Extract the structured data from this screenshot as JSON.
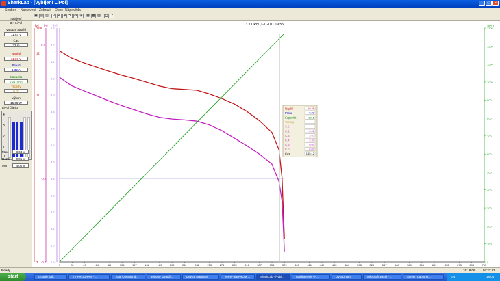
{
  "window": {
    "title": "SharkLab - [vybíjení LiPol]"
  },
  "menu": [
    "Soubor",
    "Nastavení",
    "Zobrazit",
    "Okno",
    "Nápověda"
  ],
  "toolbar": [
    "▣",
    "▤",
    "▥",
    "V",
    "A",
    "⊕",
    "℃",
    "⟳",
    "⊞",
    "▦",
    "▩",
    "▧",
    "⎙",
    "?"
  ],
  "left_panel": {
    "mode": "nabíjení",
    "battery": "3 × LiPol",
    "fields": [
      {
        "label": "Vstupní napětí",
        "value": "11.93 V",
        "color": "#000000"
      },
      {
        "label": "Čas",
        "value": "32 m",
        "color": "#000000"
      },
      {
        "label": "Napětí",
        "value": "11.00 V",
        "color": "#d00000"
      },
      {
        "label": "Proud",
        "value": "1.32 A",
        "color": "#0000c8"
      },
      {
        "label": "Kapacita",
        "value": "704 mAh",
        "color": "#008000"
      },
      {
        "label": "Teploty",
        "value": "0 °C",
        "color": "#c87800"
      },
      {
        "label": "Výkon",
        "value": "15.65 W",
        "color": "#000000"
      }
    ],
    "cells_title": "LiPol články",
    "cells_scale": [
      "4",
      "3",
      "2",
      "1",
      "0"
    ],
    "cell_levels": [
      0,
      0.88,
      0.88,
      0.88,
      0,
      0
    ],
    "max_label": "Max",
    "max_value": "3.63 V",
    "rozdil_label": "Rozd.",
    "rozdil_value": "0.01 V",
    "min_label": "Min",
    "min_value": "4.00 V"
  },
  "chart_data": {
    "type": "line",
    "title": "3 x LiPol [1-1-2011 19:55]",
    "axis_units": {
      "voltage": "[V]",
      "current": "[A]",
      "cells": "[V]",
      "capacity": "[ mAh ]"
    },
    "x_ticks": [
      1,
      22,
      43,
      64,
      85,
      106,
      127,
      148,
      169,
      190,
      211,
      232,
      253,
      274,
      295,
      316,
      337,
      358,
      379,
      400,
      421,
      442,
      463,
      484,
      505,
      526,
      547,
      568,
      589,
      610,
      631,
      652,
      673,
      694,
      715
    ],
    "x_range": [
      1,
      715
    ],
    "voltage_axis": {
      "range": [
        7,
        12.6
      ],
      "ticks": [
        {
          "value": 12.6,
          "label": "12.6"
        },
        {
          "value": 12,
          "label": "12"
        },
        {
          "value": 11,
          "label": "11"
        },
        {
          "value": 7,
          "label": "7"
        }
      ]
    },
    "current_axis": {
      "range": [
        -0.7,
        0.7
      ],
      "ticks": [
        {
          "value": 0.6,
          "label": "0.6"
        },
        {
          "value": -0.2,
          "label": "-0.2"
        },
        {
          "value": -0.7,
          "label": "-0.7"
        }
      ]
    },
    "cell_axis": {
      "range": [
        2.9,
        4.3
      ],
      "ticks": [
        "4.3",
        "4.2",
        "4.1",
        "4.0",
        "3.9",
        "3.8",
        "3.7",
        "3.6",
        "3.5",
        "3.4",
        "3.3",
        "3.2",
        "3.1",
        "3.0",
        "2.9"
      ]
    },
    "capacity_axis": {
      "range": [
        0,
        1300
      ],
      "ticks": [
        "1300",
        "1200",
        "1100",
        "1000",
        "900",
        "800",
        "700",
        "600",
        "500",
        "400",
        "300",
        "200",
        "100",
        "0"
      ]
    },
    "series": [
      {
        "name": "Napětí",
        "color": "#c01818",
        "axis": "voltage",
        "x": [
          1,
          21,
          43,
          64,
          85,
          106,
          127,
          148,
          169,
          190,
          211,
          232,
          253,
          274,
          295,
          316,
          337,
          358,
          370,
          375,
          379
        ],
        "y": [
          12.05,
          11.88,
          11.76,
          11.66,
          11.56,
          11.47,
          11.39,
          11.3,
          11.21,
          11.15,
          11.13,
          11.11,
          11.02,
          10.91,
          10.78,
          10.6,
          10.38,
          10.1,
          9.68,
          9.0,
          7.55
        ]
      },
      {
        "name": "Články",
        "color": "#c020c0",
        "axis": "voltage",
        "x": [
          1,
          21,
          43,
          64,
          85,
          106,
          127,
          148,
          169,
          190,
          211,
          232,
          253,
          274,
          295,
          316,
          337,
          358,
          370,
          375,
          379
        ],
        "y": [
          11.42,
          11.22,
          11.09,
          10.97,
          10.85,
          10.74,
          10.64,
          10.54,
          10.46,
          10.42,
          10.4,
          10.37,
          10.28,
          10.14,
          9.96,
          9.78,
          9.58,
          9.34,
          8.92,
          8.45,
          7.25
        ]
      },
      {
        "name": "Proud",
        "color": "#8080d0",
        "axis": "current",
        "x": [
          1,
          379
        ],
        "y": [
          -0.2,
          -0.2
        ]
      },
      {
        "name": "Kapacita",
        "color": "#109a10",
        "axis": "capacity",
        "x": [
          1,
          379
        ],
        "y": [
          0,
          1270
        ]
      }
    ],
    "cursor_x": 371,
    "legend": {
      "position": "right",
      "rows": [
        {
          "label": "Napětí",
          "value": "10.36",
          "color": "#c01818"
        },
        {
          "label": "Proud",
          "value": "-0.29",
          "color": "#0000c8"
        },
        {
          "label": "Kapacita",
          "value": "1215",
          "color": "#108010"
        },
        {
          "label": "Teploty",
          "value": "",
          "color": "#c0a040"
        },
        {
          "label": "Č.1",
          "value": "",
          "color": "#d080d0"
        },
        {
          "label": "Č.2",
          "value": "3.42",
          "color": "#c040c0"
        },
        {
          "label": "Č.3",
          "value": "3.43",
          "color": "#c040c0"
        },
        {
          "label": "Č.4",
          "value": "3.30",
          "color": "#c040c0"
        },
        {
          "label": "Č.5",
          "value": "0.00",
          "color": "#c040c0"
        },
        {
          "label": "Č.6",
          "value": "0.00",
          "color": "#c040c0"
        },
        {
          "label": "Čas",
          "value": "165:12",
          "color": "#000000"
        }
      ]
    }
  },
  "status": {
    "text": "Ready",
    "time1": "18:18:08",
    "time2": "07:23:43"
  },
  "taskbar": {
    "start": "start",
    "tasks": [
      {
        "label": "Google Talk",
        "active": false
      },
      {
        "label": "TV PROGRAM - ...",
        "active": false
      },
      {
        "label": "Total Command...",
        "active": false
      },
      {
        "label": "398050_19.pdf ...",
        "active": false
      },
      {
        "label": "Device Manager",
        "active": false
      },
      {
        "label": "eePe - EEPROM ...",
        "active": false
      },
      {
        "label": "SharkLab - [vybí...",
        "active": true
      },
      {
        "label": "napájamerik - N...",
        "active": false
      },
      {
        "label": "DVB Dream",
        "active": false
      },
      {
        "label": "Microsoft Excel - ...",
        "active": false
      },
      {
        "label": "Screen Capturer...",
        "active": false
      }
    ],
    "tray_lang": "EN",
    "clock": "18:04"
  }
}
